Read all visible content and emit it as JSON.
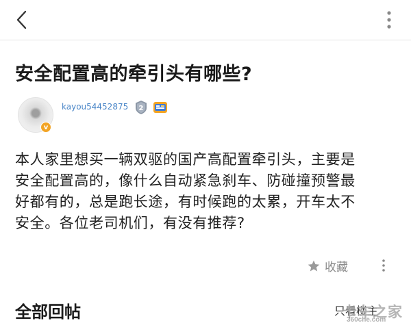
{
  "header": {
    "back_icon": "chevron-left-icon",
    "more_icon": "vertical-dots-icon"
  },
  "post": {
    "title": "安全配置高的牵引头有哪些?",
    "author": {
      "username": "kayou54452875",
      "level": "2",
      "verified_badge": "v"
    },
    "body_lines": [
      "本人家里想买一辆双驱的国产高配置牵引头，主要是",
      "安全配置高的，像什么自动紧急刹车、防碰撞预警最",
      "好都有的，总是跑长途，有时候跑的太累，开车太不",
      "安全。各位老司机们，有没有推荐?"
    ],
    "favorite_label": "收藏"
  },
  "replies": {
    "section_title": "全部回帖",
    "filter_label": "只看楼主"
  },
  "watermark": {
    "main": "卡车之家",
    "sub": "360che.com"
  },
  "colors": {
    "username": "#4a86c8",
    "gold_badge": "#f2a425",
    "muted": "#8a8a8a"
  }
}
